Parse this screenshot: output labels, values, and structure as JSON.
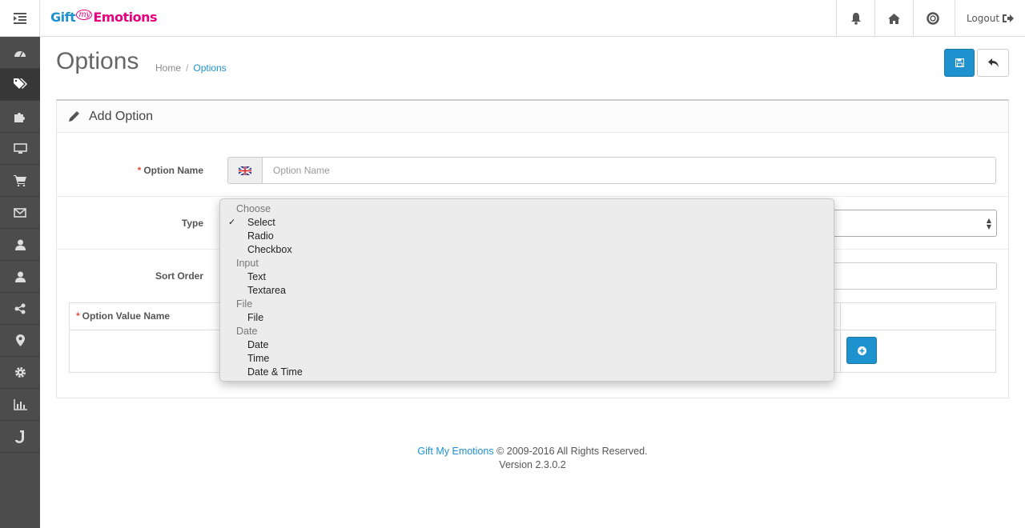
{
  "header": {
    "logo": {
      "part1": "Gift",
      "part2": "my",
      "part3": "Emotions"
    },
    "logout_label": "Logout"
  },
  "page": {
    "title": "Options",
    "breadcrumb": [
      "Home",
      "Options"
    ]
  },
  "panel": {
    "title": "Add Option",
    "option_name_label": "Option Name",
    "option_name_placeholder": "Option Name",
    "type_label": "Type",
    "sort_order_label": "Sort Order",
    "option_value_name_label": "Option Value Name",
    "required_mark": "*"
  },
  "type_dropdown": {
    "selected": "Select",
    "check_mark": "✓",
    "groups": [
      {
        "label": "Choose",
        "options": [
          "Select",
          "Radio",
          "Checkbox"
        ]
      },
      {
        "label": "Input",
        "options": [
          "Text",
          "Textarea"
        ]
      },
      {
        "label": "File",
        "options": [
          "File"
        ]
      },
      {
        "label": "Date",
        "options": [
          "Date",
          "Time",
          "Date & Time"
        ]
      }
    ]
  },
  "footer": {
    "brand_link": "Gift My Emotions",
    "copyright": "© 2009-2016 All Rights Reserved.",
    "version": "Version 2.3.0.2"
  },
  "icons": {
    "header": [
      "menu-toggle-icon",
      "bell-icon",
      "home-icon",
      "life-ring-icon",
      "sign-out-icon"
    ],
    "sidebar": [
      "dashboard-icon",
      "tags-icon",
      "puzzle-icon",
      "desktop-icon",
      "cart-icon",
      "envelope-icon",
      "user-icon",
      "user-icon",
      "share-icon",
      "map-marker-icon",
      "cog-icon",
      "bar-chart-icon",
      "joomla-icon"
    ]
  },
  "colors": {
    "primary": "#1e91cf",
    "brand_pink": "#e6007e",
    "sidebar": "#4c4c4c",
    "required": "#e3503e"
  }
}
